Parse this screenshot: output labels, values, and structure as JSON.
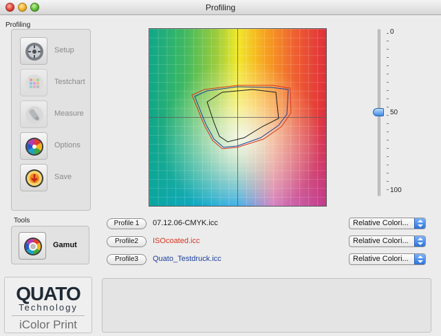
{
  "window": {
    "title": "Profiling"
  },
  "sidebar": {
    "section_label": "Profiling",
    "items": [
      {
        "label": "Setup",
        "icon": "setup-icon"
      },
      {
        "label": "Testchart",
        "icon": "testchart-icon"
      },
      {
        "label": "Measure",
        "icon": "measure-icon"
      },
      {
        "label": "Options",
        "icon": "options-icon"
      },
      {
        "label": "Save",
        "icon": "save-icon"
      }
    ]
  },
  "tools": {
    "section_label": "Tools",
    "gamut_label": "Gamut",
    "icon": "gamut-icon"
  },
  "logo": {
    "brand": "QUATO",
    "subtitle": "Technology",
    "product": "iColor Print"
  },
  "slider": {
    "top_label": "0",
    "mid_label": "50",
    "bottom_label": "100",
    "value": 50
  },
  "profiles": [
    {
      "button": "Profile 1",
      "file": "07.12.06-CMYK.icc",
      "color": "#1a1a1a",
      "intent": "Relative Colori..."
    },
    {
      "button": "Profile2",
      "file": "ISOcoated.icc",
      "color": "#d8331f",
      "intent": "Relative Colori..."
    },
    {
      "button": "Profile3",
      "file": "Quato_Testdruck.icc",
      "color": "#1d3f9a",
      "intent": "Relative Colori..."
    }
  ],
  "colors": {
    "accent": "#3f8ae0",
    "profile1": "#1a1a1a",
    "profile2": "#d8331f",
    "profile3": "#1d3f9a"
  }
}
